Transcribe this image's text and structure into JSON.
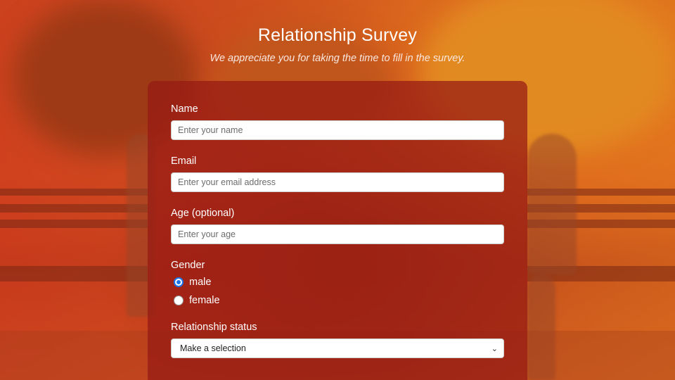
{
  "header": {
    "title": "Relationship Survey",
    "subtitle": "We appreciate you for taking the time to fill in the survey."
  },
  "form": {
    "name": {
      "label": "Name",
      "placeholder": "Enter your name"
    },
    "email": {
      "label": "Email",
      "placeholder": "Enter your email address"
    },
    "age": {
      "label": "Age (optional)",
      "placeholder": "Enter your age"
    },
    "gender": {
      "label": "Gender",
      "options": [
        {
          "label": "male",
          "checked": true
        },
        {
          "label": "female",
          "checked": false
        }
      ]
    },
    "relationship": {
      "label": "Relationship status",
      "selected": "Make a selection"
    }
  },
  "colors": {
    "card": "#961914",
    "radio_accent": "#1a73e8",
    "background": "#c8401e"
  },
  "icons": {
    "select_arrow": "chevron-down-icon"
  }
}
